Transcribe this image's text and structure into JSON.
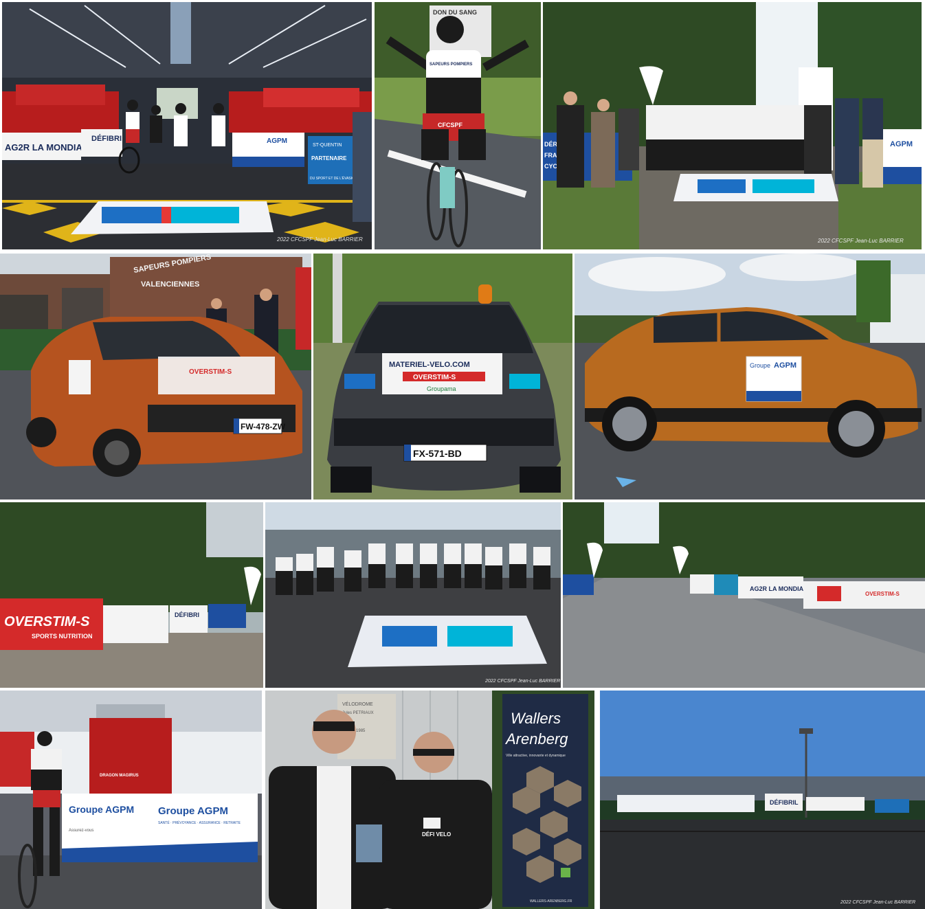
{
  "collage": {
    "tile1": {
      "banner_left": "AG2R LA MONDIALE",
      "banner_mid": "DÉFIBRI",
      "banner_agpm": "AGPM",
      "banner_right_1": "ST-QUENTIN",
      "banner_right_2": "PARTENAIRE",
      "banner_right_3": "DU SPORT ET DE L'ÉVASION",
      "credit": "2022 CFCSPF Jean-Luc BARRIER"
    },
    "tile2": {
      "sign": "DON DU SANG",
      "jersey_top": "SAPEURS POMPIERS",
      "jersey_bottom": "CFCSPF"
    },
    "tile3": {
      "banner_left_1": "DÉRATION",
      "banner_left_2": "FRANÇAISE",
      "banner_left_3": "CYCLISME",
      "banner_right": "AGPM",
      "credit": "2022 CFCSPF Jean-Luc BARRIER"
    },
    "tile4": {
      "building_sign_1": "SAPEURS POMPIERS",
      "building_sign_2": "VALENCIENNES",
      "plate": "FW-478-ZW",
      "hood": "OVERSTIM-S"
    },
    "tile5": {
      "hood_1": "MATERIEL-VELO.COM",
      "hood_2": "OVERSTIM-S",
      "hood_3": "Groupama",
      "plate": "FX-571-BD"
    },
    "tile6": {
      "door_1": "Groupe",
      "door_2": "AGPM"
    },
    "tile7": {
      "banner_1": "OVERSTIM-S",
      "banner_2": "SPORTS NUTRITION",
      "banner_3": "DÉFIBRI"
    },
    "tile8": {
      "credit": "2022 CFCSPF Jean-Luc BARRIER"
    },
    "tile9": {
      "banner_1": "AG2R LA MONDIALE",
      "banner_2": "OVERSTIM-S"
    },
    "tile10": {
      "banner_1": "Groupe AGPM",
      "banner_2": "Groupe AGPM",
      "banner_sub": "SANTÉ · PRÉVOYANCE · ASSURANCE · RETRAITE",
      "banner_small": "Assurez-vous",
      "truck": "DRAGON MAGIRUS"
    },
    "tile11": {
      "plaque_1": "VÉLODROME",
      "plaque_2": "Jules PETRIAUX",
      "plaque_3": "1977 – 1985",
      "jacket": "DÉFI VELO",
      "rollup_1": "Wallers",
      "rollup_2": "Arenberg",
      "rollup_sub": "Ville attractive, innovante et dynamique",
      "rollup_url": "WALLERS-ARENBERG.FR"
    },
    "tile12": {
      "banner": "DÉFIBRIL",
      "credit": "2022 CFCSPF Jean-Luc BARRIER"
    }
  },
  "colors": {
    "cic_blue": "#1d6fc4",
    "cic_cyan": "#00b4d8",
    "agpm_blue": "#1e4fa0",
    "overstim_red": "#d42a2a",
    "car_orange": "#b5531f",
    "car_grey": "#3a3d42"
  }
}
